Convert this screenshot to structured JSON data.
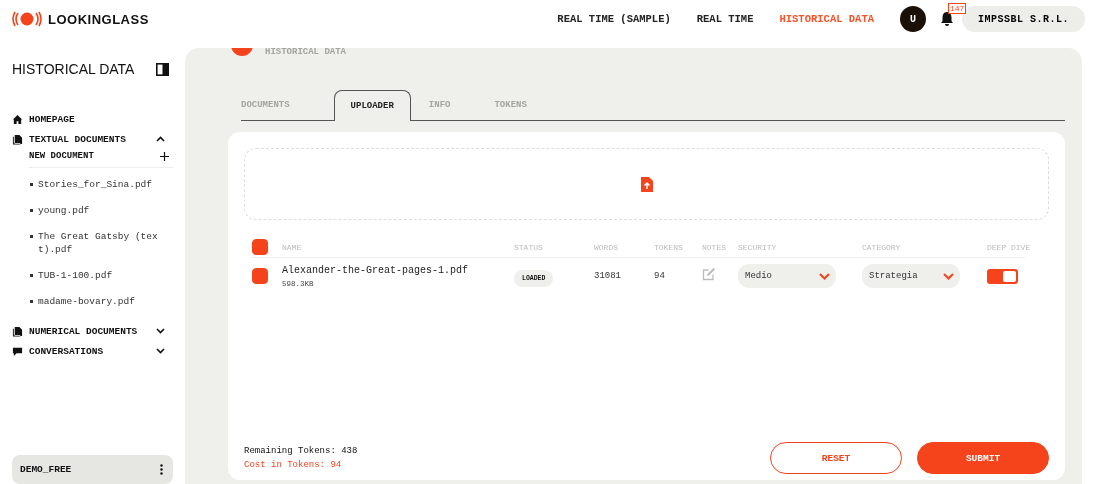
{
  "header": {
    "logo": "LOOKINGLASS",
    "nav": [
      {
        "label": "REAL TIME (SAMPLE)",
        "selected": false
      },
      {
        "label": "REAL TIME",
        "selected": false
      },
      {
        "label": "HISTORICAL DATA",
        "selected": true
      }
    ],
    "avatar": "U",
    "notifications": "147",
    "account": "IMPSSBL S.R.L."
  },
  "sidebar": {
    "title": "HISTORICAL DATA",
    "items": [
      {
        "kind": "home",
        "label": "HOMEPAGE"
      },
      {
        "kind": "docs",
        "label": "TEXTUAL DOCUMENTS",
        "expanded": true,
        "action": "NEW DOCUMENT",
        "children": [
          {
            "label": "Stories_for_Sina.pdf"
          },
          {
            "label": "young.pdf"
          },
          {
            "label": "The Great Gatsby (tex t).pdf"
          },
          {
            "label": "TUB-1-100.pdf"
          },
          {
            "label": "madame-bovary.pdf"
          }
        ]
      },
      {
        "kind": "docs",
        "label": "NUMERICAL DOCUMENTS",
        "expanded": false
      },
      {
        "kind": "chat",
        "label": "CONVERSATIONS",
        "expanded": false
      }
    ],
    "plan": "DEMO_FREE"
  },
  "main": {
    "breadcrumb": "HISTORICAL DATA",
    "tabs": [
      {
        "label": "DOCUMENTS",
        "selected": false
      },
      {
        "label": "UPLOADER",
        "selected": true
      },
      {
        "label": "INFO",
        "selected": false
      },
      {
        "label": "TOKENS",
        "selected": false
      }
    ],
    "table": {
      "all_checked": true,
      "columns": [
        "NAME",
        "STATUS",
        "WORDS",
        "TOKENS",
        "NOTES",
        "SECURITY",
        "CATEGORY",
        "DEEP DIVE"
      ],
      "rows": [
        {
          "checked": true,
          "name": "Alexander-the-Great-pages-1.pdf",
          "size": "598.3KB",
          "status": "LOADED",
          "words": "31081",
          "tokens": "94",
          "security": "Medio",
          "category": "Strategia",
          "deep_dive": true
        }
      ]
    },
    "remaining": "Remaining Tokens: 438",
    "cost": "Cost in Tokens: 94",
    "buttons": [
      {
        "kind": "secondary",
        "label": "RESET"
      },
      {
        "kind": "primary",
        "label": "SUBMIT"
      }
    ]
  }
}
